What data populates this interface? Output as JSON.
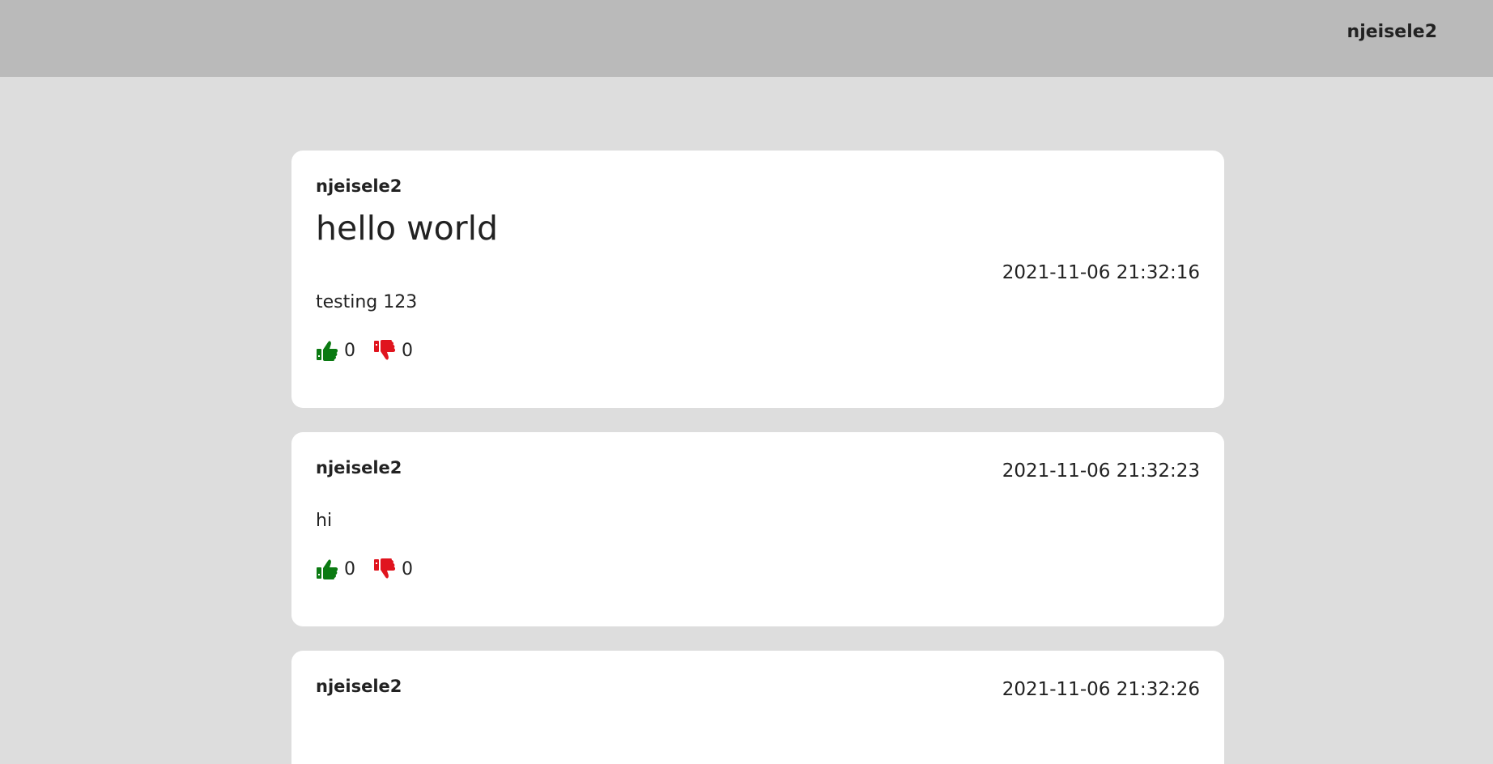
{
  "header": {
    "username": "njeisele2"
  },
  "colors": {
    "upvote": "#0b7a12",
    "downvote": "#e0141e"
  },
  "posts": [
    {
      "author": "njeisele2",
      "title": "hello world",
      "timestamp": "2021-11-06 21:32:16",
      "body": "testing 123",
      "upvotes": "0",
      "downvotes": "0"
    },
    {
      "author": "njeisele2",
      "timestamp": "2021-11-06 21:32:23",
      "body": "hi",
      "upvotes": "0",
      "downvotes": "0"
    },
    {
      "author": "njeisele2",
      "timestamp": "2021-11-06 21:32:26"
    }
  ]
}
